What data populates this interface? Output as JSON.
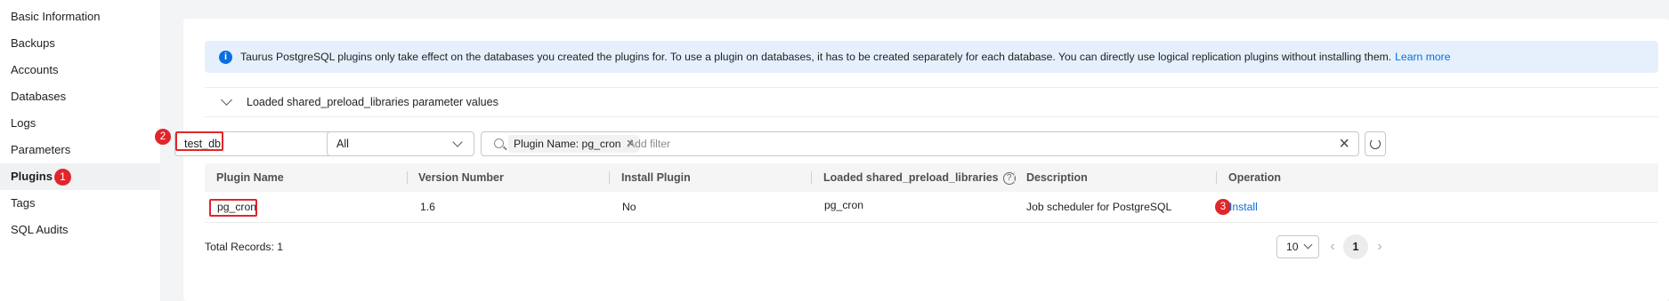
{
  "sidebar": {
    "items": [
      {
        "label": "Basic Information"
      },
      {
        "label": "Backups"
      },
      {
        "label": "Accounts"
      },
      {
        "label": "Databases"
      },
      {
        "label": "Logs"
      },
      {
        "label": "Parameters"
      },
      {
        "label": "Plugins",
        "active": true,
        "badge": "1"
      },
      {
        "label": "Tags"
      },
      {
        "label": "SQL Audits"
      }
    ]
  },
  "info": {
    "text": "Taurus PostgreSQL plugins only take effect on the databases you created the plugins for. To use a plugin on databases, it has to be created separately for each database. You can directly use logical replication plugins without installing them.",
    "link": "Learn more"
  },
  "collapse": {
    "label": "Loaded shared_preload_libraries parameter values"
  },
  "filters": {
    "database_select": "test_db",
    "database_badge": "2",
    "status_select": "All",
    "search_tag": "Plugin Name: pg_cron",
    "search_placeholder": "Add filter"
  },
  "table": {
    "headers": [
      "Plugin Name",
      "Version Number",
      "Install Plugin",
      "Loaded shared_preload_libraries",
      "Description",
      "Operation"
    ],
    "rows": [
      {
        "plugin_name": "pg_cron",
        "version": "1.6",
        "install_plugin": "No",
        "loaded": "pg_cron",
        "description": "Job scheduler for PostgreSQL",
        "operation": "Install",
        "operation_badge": "3"
      }
    ]
  },
  "pagination": {
    "total": "Total Records: 1",
    "page_size": "10",
    "current_page": "1"
  },
  "colors": {
    "accent": "#0b6ee0",
    "highlight": "#e0262b",
    "info_bg": "#e5f0fc"
  }
}
